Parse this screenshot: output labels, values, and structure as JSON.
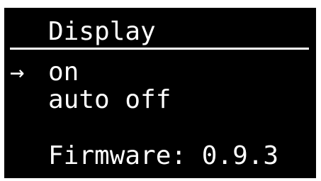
{
  "screen": {
    "title": "Display",
    "cursor": "→",
    "menu_items": [
      {
        "label": "on",
        "selected": true
      },
      {
        "label": "auto off",
        "selected": false
      }
    ],
    "firmware_text": "Firmware: 0.9.3"
  },
  "colors": {
    "background": "#000000",
    "foreground": "#ffffff"
  }
}
